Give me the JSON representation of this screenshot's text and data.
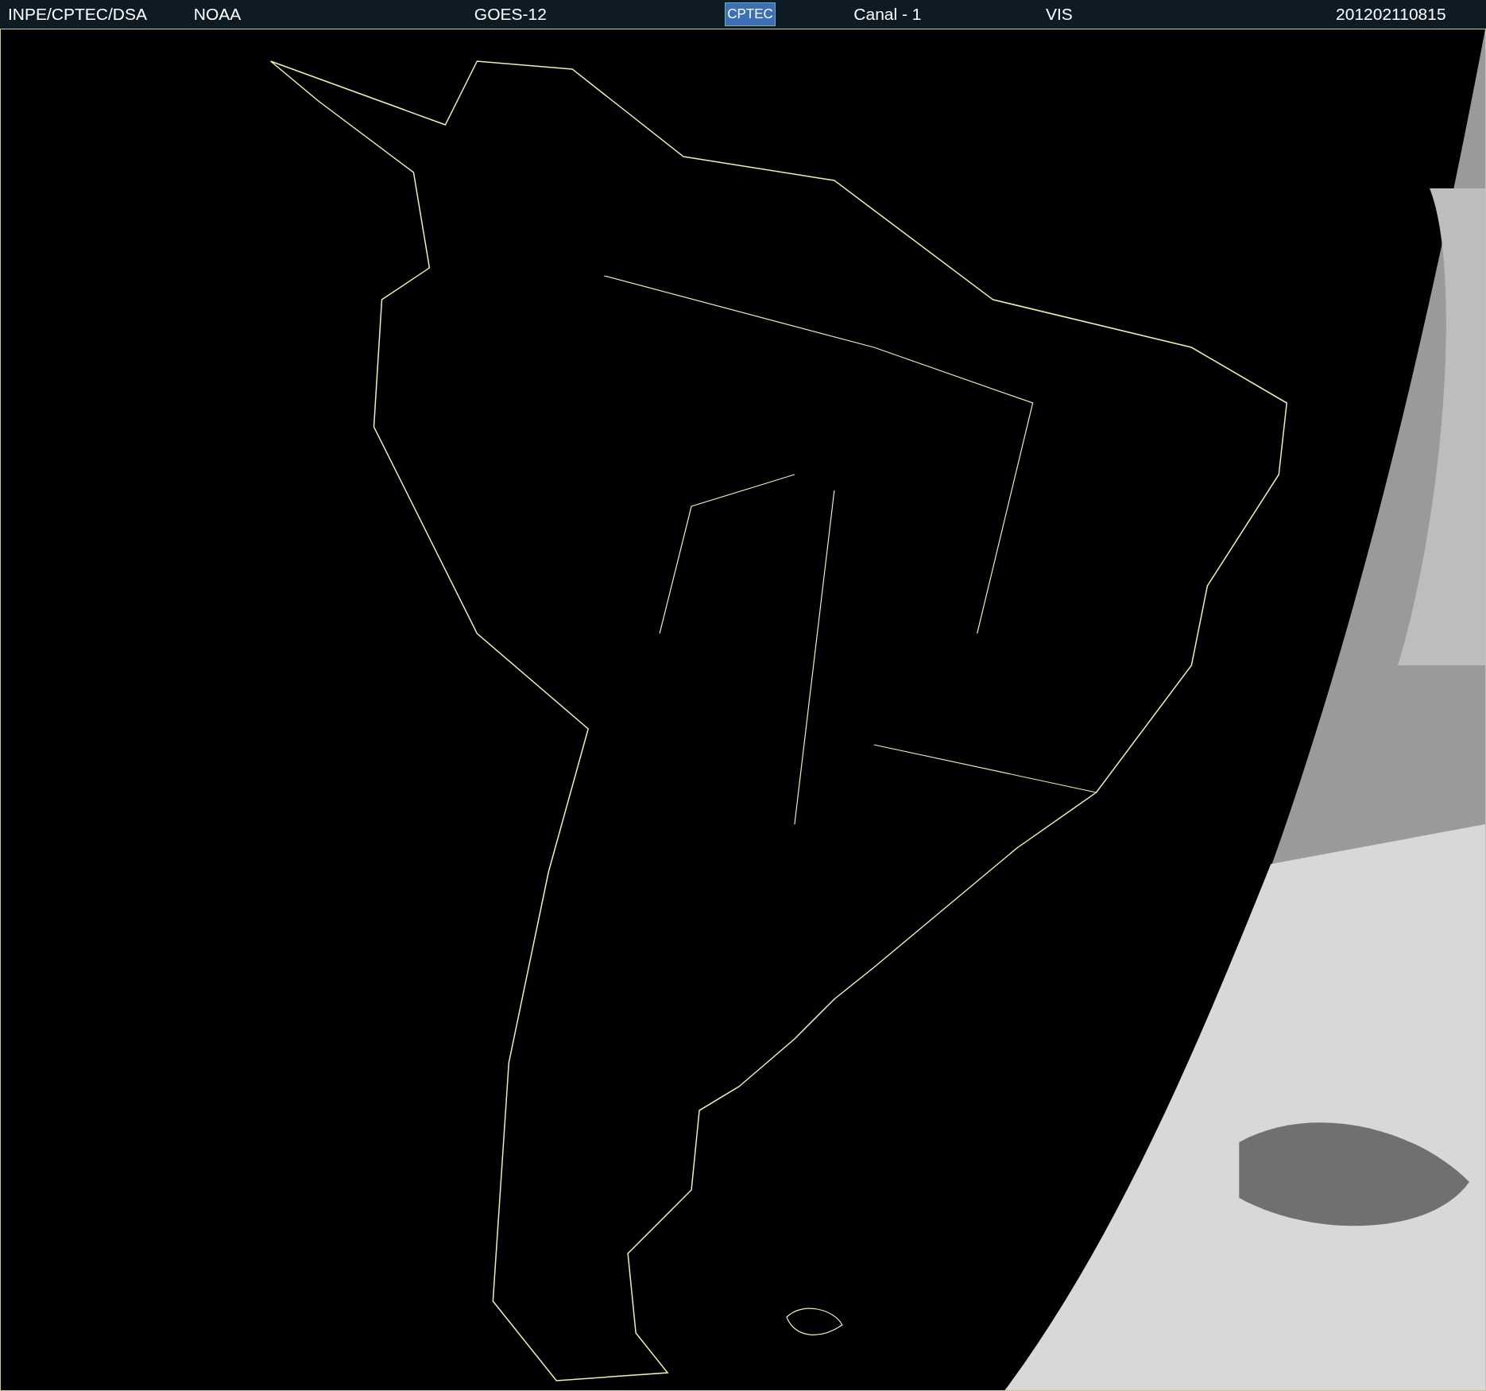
{
  "header": {
    "items": [
      {
        "kind": "text",
        "label": "INPE/CPTEC/DSA"
      },
      {
        "kind": "text",
        "label": "NOAA"
      },
      {
        "kind": "text",
        "label": "GOES-12"
      },
      {
        "kind": "logo",
        "label": "CPTEC"
      },
      {
        "kind": "text",
        "label": "Canal - 1"
      },
      {
        "kind": "text",
        "label": "VIS"
      },
      {
        "kind": "text",
        "label": "201202110815"
      }
    ]
  }
}
